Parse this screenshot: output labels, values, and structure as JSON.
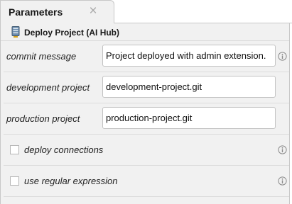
{
  "tab": {
    "label": "Parameters",
    "close_glyph": "×"
  },
  "panel": {
    "title": "Deploy Project (AI Hub)",
    "icon": "server-icon"
  },
  "fields": [
    {
      "label": "commit message",
      "value": "Project deployed with admin extension."
    },
    {
      "label": "development project",
      "value": "development-project.git"
    },
    {
      "label": "production project",
      "value": "production-project.git"
    }
  ],
  "checkboxes": [
    {
      "label": "deploy connections",
      "checked": false
    },
    {
      "label": "use regular expression",
      "checked": false
    }
  ],
  "icons": {
    "info": "info-icon",
    "close": "close-icon"
  }
}
